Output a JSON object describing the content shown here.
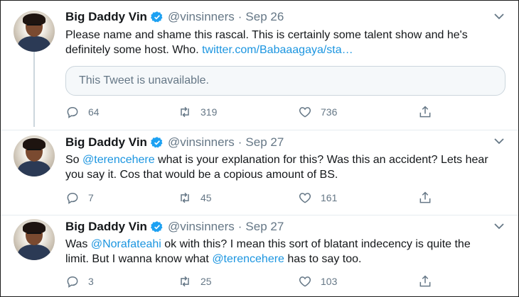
{
  "tweets": [
    {
      "author_name": "Big Daddy Vin",
      "handle": "@vinsinners",
      "separator": "·",
      "date": "Sep 26",
      "text_before": "Please name and shame this rascal. This is certainly some talent show and he's definitely some host. Who. ",
      "link": "twitter.com/Babaaagaya/sta…",
      "quoted_notice": "This Tweet is unavailable.",
      "replies": "64",
      "retweets": "319",
      "likes": "736"
    },
    {
      "author_name": "Big Daddy Vin",
      "handle": "@vinsinners",
      "separator": "·",
      "date": "Sep 27",
      "text_before": "So ",
      "mention": "@terencehere",
      "text_after": " what is your explanation for this? Was this an accident? Lets hear you say it. Cos that would be a copious amount of BS.",
      "replies": "7",
      "retweets": "45",
      "likes": "161"
    },
    {
      "author_name": "Big Daddy Vin",
      "handle": "@vinsinners",
      "separator": "·",
      "date": "Sep 27",
      "text_before": "Was ",
      "mention": "@Norafateahi",
      "text_middle": " ok with this? I mean this sort of blatant indecency is quite the limit. But I wanna know what ",
      "mention2": "@terencehere",
      "text_after": " has to say too.",
      "replies": "3",
      "retweets": "25",
      "likes": "103"
    }
  ],
  "icons": {
    "verified": "verified-badge-icon",
    "reply": "reply-icon",
    "retweet": "retweet-icon",
    "like": "heart-icon",
    "share": "share-icon",
    "more": "chevron-down-icon"
  },
  "colors": {
    "link": "#1b95e0",
    "secondary_text": "#657786",
    "verified": "#1da1f2"
  }
}
